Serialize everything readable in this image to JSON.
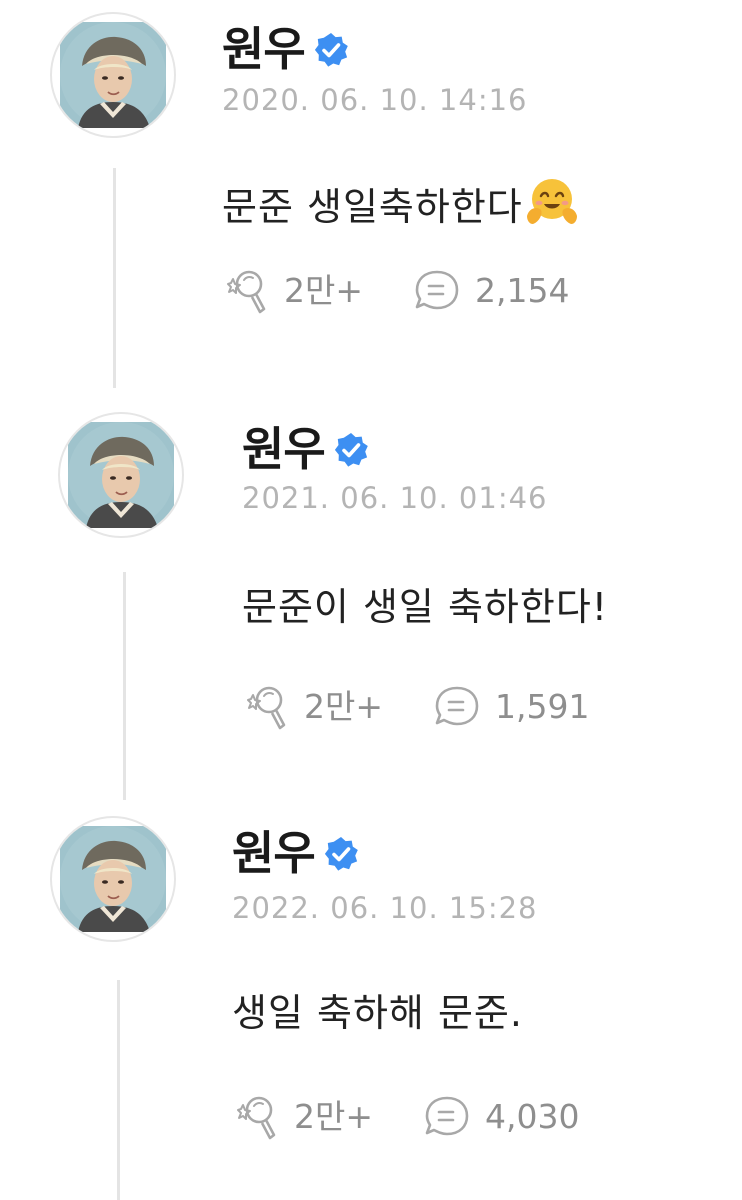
{
  "posts": [
    {
      "author": "원우",
      "timestamp": "2020. 06. 10. 14:16",
      "text": "문준 생일축하한다",
      "emoji": "hugging-face-emoji",
      "likes": "2만+",
      "comments": "2,154"
    },
    {
      "author": "원우",
      "timestamp": "2021. 06. 10. 01:46",
      "text": "문준이 생일 축하한다!",
      "likes": "2만+",
      "comments": "1,591"
    },
    {
      "author": "원우",
      "timestamp": "2022. 06. 10. 15:28",
      "text": "생일 축하해 문준.",
      "likes": "2만+",
      "comments": "4,030"
    }
  ],
  "colors": {
    "verified_badge": "#3d8ff2",
    "timestamp": "#b4b4b4",
    "stat_text": "#8e8e8e",
    "thread_line": "#e4e4e4"
  }
}
